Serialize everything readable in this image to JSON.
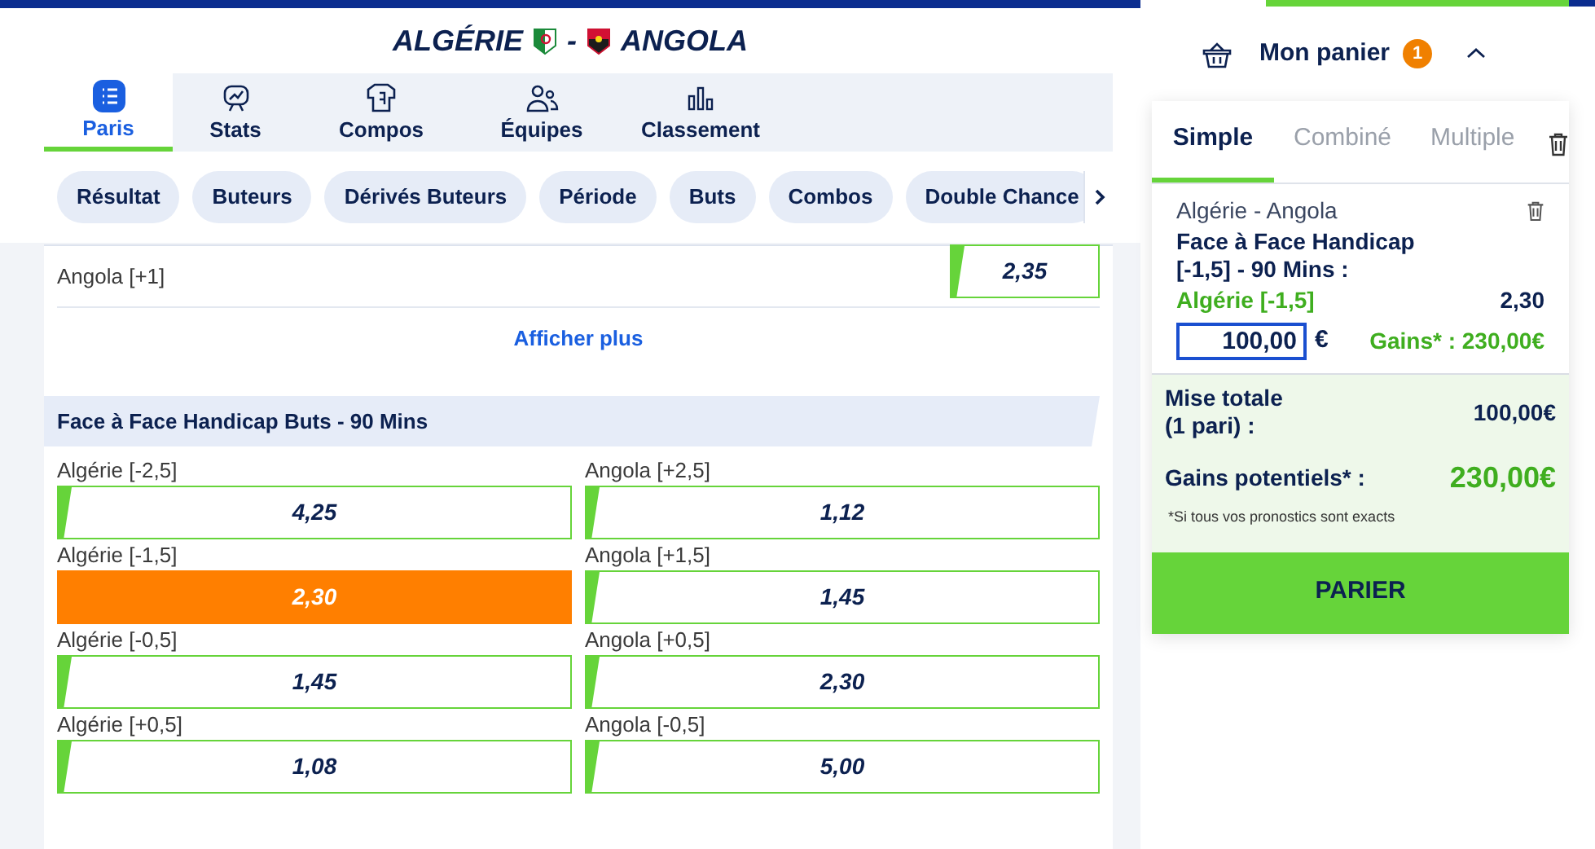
{
  "match": {
    "home": "ALGÉRIE",
    "separator": "-",
    "away": "ANGOLA"
  },
  "tabs": [
    {
      "label": "Paris",
      "selected": true
    },
    {
      "label": "Stats",
      "selected": false
    },
    {
      "label": "Compos",
      "selected": false
    },
    {
      "label": "Équipes",
      "selected": false
    },
    {
      "label": "Classement",
      "selected": false
    }
  ],
  "chips": [
    "Résultat",
    "Buteurs",
    "Dérivés Buteurs",
    "Période",
    "Buts",
    "Combos",
    "Double Chance"
  ],
  "previous_market": {
    "outcome": "Angola [+1]",
    "odds": "2,35",
    "selected": false
  },
  "show_more": "Afficher plus",
  "market": {
    "title": "Face à Face Handicap Buts - 90 Mins",
    "outcomes": [
      {
        "label": "Algérie [-2,5]",
        "odds": "4,25",
        "selected": false
      },
      {
        "label": "Angola [+2,5]",
        "odds": "1,12",
        "selected": false
      },
      {
        "label": "Algérie [-1,5]",
        "odds": "2,30",
        "selected": true
      },
      {
        "label": "Angola [+1,5]",
        "odds": "1,45",
        "selected": false
      },
      {
        "label": "Algérie [-0,5]",
        "odds": "1,45",
        "selected": false
      },
      {
        "label": "Angola [+0,5]",
        "odds": "2,30",
        "selected": false
      },
      {
        "label": "Algérie [+0,5]",
        "odds": "1,08",
        "selected": false
      },
      {
        "label": "Angola [-0,5]",
        "odds": "5,00",
        "selected": false
      }
    ]
  },
  "basket": {
    "title": "Mon panier",
    "count": "1",
    "expanded": true,
    "tabs": [
      {
        "label": "Simple",
        "selected": true
      },
      {
        "label": "Combiné",
        "selected": false
      },
      {
        "label": "Multiple",
        "selected": false
      }
    ],
    "bet": {
      "match": "Algérie - Angola",
      "market": "Face à Face Handicap [-1,5] - 90 Mins :",
      "selection": "Algérie [-1,5]",
      "odds": "2,30",
      "stake": "100,00",
      "currency": "€",
      "gains": "Gains* : 230,00€"
    },
    "total_label": "Mise totale (1 pari) :",
    "total_value": "100,00€",
    "potential_label": "Gains potentiels* :",
    "potential_value": "230,00€",
    "note": "*Si tous vos pronostics sont exacts",
    "submit": "PARIER"
  }
}
